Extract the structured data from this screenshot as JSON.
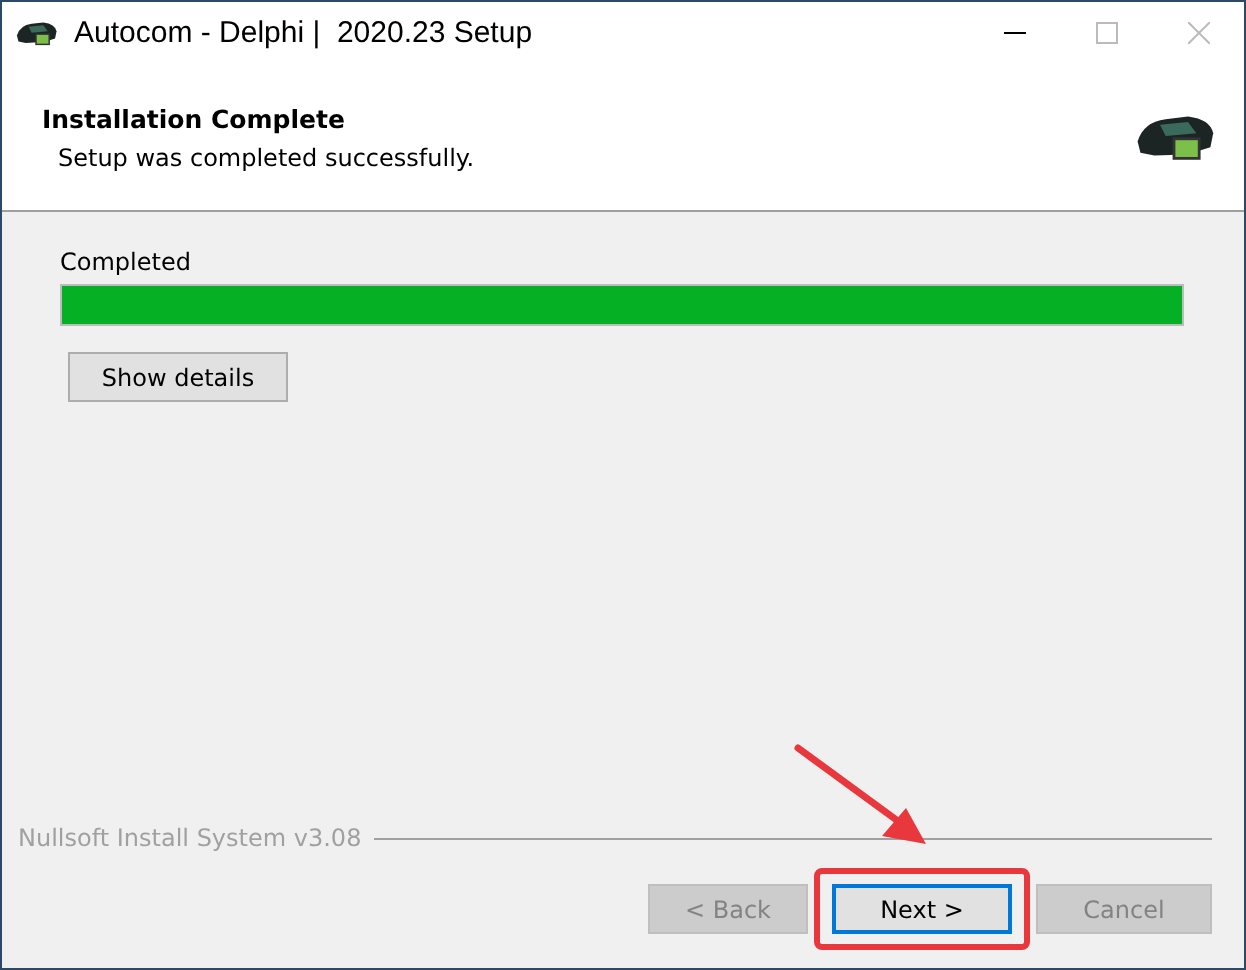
{
  "window": {
    "title": "Autocom - Delphi |  2020.23 Setup"
  },
  "header": {
    "title": "Installation Complete",
    "subtitle": "Setup was completed successfully."
  },
  "progress": {
    "label": "Completed",
    "level": 1
  },
  "details_button": {
    "label": "Show details"
  },
  "branding": "Nullsoft Install System v3.08",
  "buttons": [
    {
      "label": "< Back",
      "disabled": true,
      "focused": false,
      "highlighted": false
    },
    {
      "label": "Next >",
      "disabled": false,
      "focused": true,
      "highlighted": true
    },
    {
      "label": "Cancel",
      "disabled": true,
      "focused": false,
      "highlighted": false
    }
  ]
}
